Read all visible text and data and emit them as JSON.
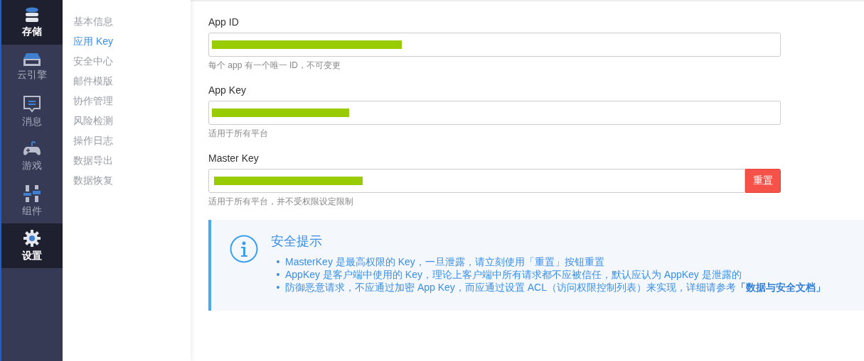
{
  "nav": [
    {
      "label": "存储",
      "selected": true
    },
    {
      "label": "云引擎",
      "selected": false
    },
    {
      "label": "消息",
      "selected": false
    },
    {
      "label": "游戏",
      "selected": false
    },
    {
      "label": "组件",
      "selected": false
    },
    {
      "label": "设置",
      "selected": true
    }
  ],
  "submenu": [
    {
      "label": "基本信息",
      "selected": false
    },
    {
      "label": "应用 Key",
      "selected": true
    },
    {
      "label": "安全中心",
      "selected": false
    },
    {
      "label": "邮件模版",
      "selected": false
    },
    {
      "label": "协作管理",
      "selected": false
    },
    {
      "label": "风险检测",
      "selected": false
    },
    {
      "label": "操作日志",
      "selected": false
    },
    {
      "label": "数据导出",
      "selected": false
    },
    {
      "label": "数据恢复",
      "selected": false
    }
  ],
  "fields": [
    {
      "label": "App ID",
      "hint": "每个 app 有一个唯一 ID，不可变更"
    },
    {
      "label": "App Key",
      "hint": "适用于所有平台"
    },
    {
      "label": "Master Key",
      "hint": "适用于所有平台，并不受权限设定限制",
      "button": "重置"
    }
  ],
  "notice": {
    "title": "安全提示",
    "items": [
      {
        "bullet": "•",
        "text": "MasterKey 是最高权限的 Key，一旦泄露，请立刻使用「重置」按钮重置"
      },
      {
        "bullet": "•",
        "text": "AppKey 是客户端中使用的 Key，理论上客户端中所有请求都不应被信任，默认应认为 AppKey 是泄露的"
      },
      {
        "bullet": "•",
        "text": "防御恶意请求，不应通过加密 App Key，而应通过设置 ACL（访问权限控制列表）来实现，详细请参考 ",
        "link": "「数据与安全文档」"
      }
    ]
  }
}
